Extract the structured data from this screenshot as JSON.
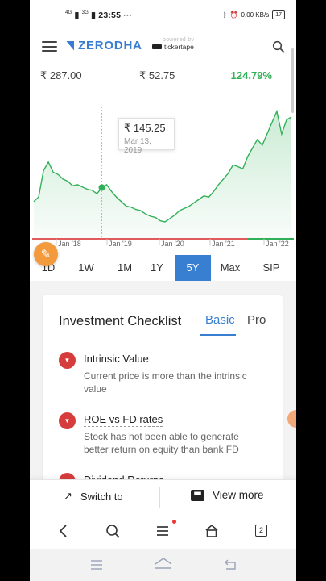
{
  "status_bar": {
    "network": "4G",
    "network2": "3G",
    "time": "23:55",
    "more": "···",
    "speed": "0.00 KB/s",
    "battery": "17"
  },
  "header": {
    "brand": "ZERODHA",
    "powered_by": "powered by",
    "partner": "tickertape"
  },
  "stats": {
    "low": "₹ 287.00",
    "high": "₹ 52.75",
    "change": "124.79%"
  },
  "chart_data": {
    "type": "area",
    "x": [
      "Jan '18",
      "Jan '19",
      "Jan '20",
      "Jan '21",
      "Jan '22"
    ],
    "tooltip_price": "₹ 145.25",
    "tooltip_date": "Mar 13, 2019",
    "colors": {
      "line": "#31b157",
      "fill": "#31b157",
      "axis_red": "#e15b5b",
      "axis_green": "#31b157"
    },
    "series": [
      {
        "values": [
          120,
          128,
          175,
          190,
          172,
          168,
          160,
          156,
          148,
          150,
          146,
          142,
          140,
          134,
          145,
          150,
          138,
          128,
          120,
          112,
          110,
          106,
          104,
          98,
          94,
          92,
          86,
          84,
          90,
          96,
          104,
          108,
          112,
          118,
          124,
          130,
          128,
          138,
          150,
          160,
          170,
          185,
          182,
          178,
          200,
          215,
          230,
          220,
          240,
          260,
          280,
          240,
          265,
          270
        ]
      }
    ]
  },
  "range_tabs": [
    {
      "label": "1D",
      "active": false
    },
    {
      "label": "1W",
      "active": false
    },
    {
      "label": "1M",
      "active": false
    },
    {
      "label": "1Y",
      "active": false
    },
    {
      "label": "5Y",
      "active": true
    },
    {
      "label": "Max",
      "active": false
    },
    {
      "label": "SIP",
      "active": false
    }
  ],
  "checklist": {
    "title": "Investment Checklist",
    "tab_basic": "Basic",
    "tab_pro": "Pro",
    "items": [
      {
        "title": "Intrinsic Value",
        "desc": "Current price is more than the intrinsic value"
      },
      {
        "title": "ROE vs FD rates",
        "desc": "Stock has not been able to generate better return on equity than bank FD"
      },
      {
        "title": "Dividend Returns",
        "desc": ""
      }
    ]
  },
  "actions": {
    "switch": "Switch to",
    "view_more": "View more"
  },
  "browser": {
    "tab_count": "2"
  }
}
